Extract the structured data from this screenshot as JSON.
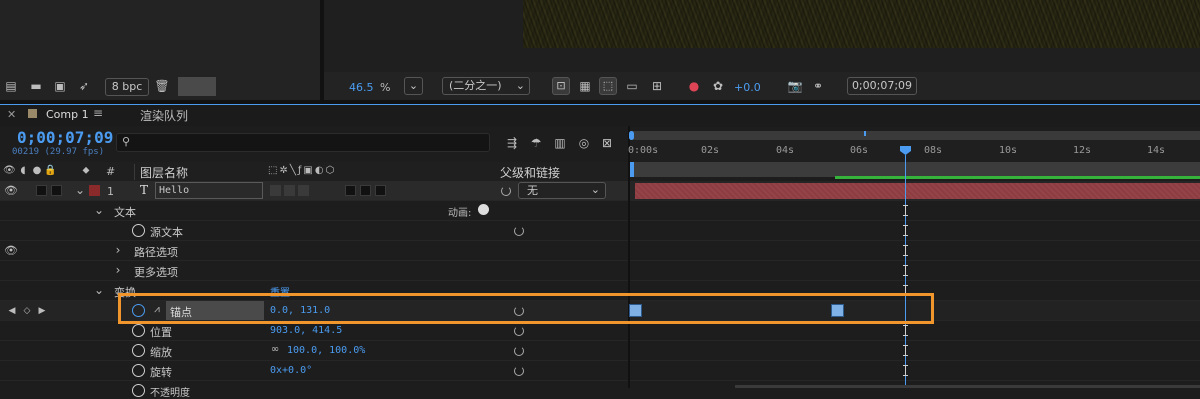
{
  "project_toolbar": {
    "bpc_label": "8 bpc"
  },
  "viewer_toolbar": {
    "zoom_value": "46.5",
    "zoom_unit": "%",
    "resolution": "(二分之一)",
    "exposure": "+0.0",
    "timecode": "0;00;07;09"
  },
  "tabs": {
    "comp": "Comp 1",
    "render_queue": "渲染队列"
  },
  "timeline": {
    "current_time": "0;00;07;09",
    "frame_info": "00219 (29.97 fps)",
    "search_placeholder": "",
    "columns": {
      "hash": "#",
      "layer_name": "图层名称",
      "parent_link": "父级和链接"
    },
    "layer": {
      "index": "1",
      "type_icon": "T",
      "name": "Hello",
      "parent_value": "无"
    },
    "props": {
      "text_group": "文本",
      "animate_label": "动画:",
      "source_text": "源文本",
      "path_options": "路径选项",
      "more_options": "更多选项",
      "transform": "变换",
      "reset": "重置",
      "anchor_point": "锚点",
      "anchor_value": "0.0, 131.0",
      "position": "位置",
      "position_value": "903.0, 414.5",
      "scale": "缩放",
      "scale_value": "100.0, 100.0%",
      "rotation": "旋转",
      "rotation_value": "0x+0.0°",
      "opacity": "不透明度"
    },
    "ruler_ticks": [
      "0:00s",
      "02s",
      "04s",
      "06s",
      "08s",
      "10s",
      "12s",
      "14s"
    ],
    "colors": {
      "accent_blue": "#4b9cf1",
      "highlight_orange": "#f0962d",
      "layer_bar": "#8e3c42",
      "work_area_green": "#35b33b"
    }
  }
}
